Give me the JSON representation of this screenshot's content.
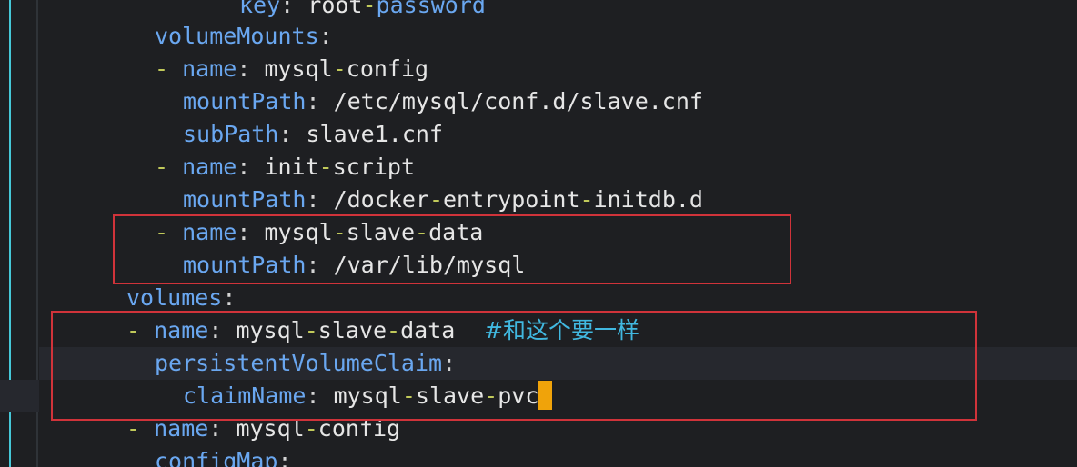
{
  "editor": {
    "lines": [
      {
        "key": "key",
        "sep": ": ",
        "value": [
          {
            "t": "root"
          },
          {
            "t": "-",
            "dash": true
          },
          {
            "t": "password",
            "blue": true
          }
        ]
      },
      {
        "key": "volumeMounts",
        "sep": ":"
      },
      {
        "dash": "- ",
        "key": "name",
        "sep": ": ",
        "value": [
          {
            "t": "mysql"
          },
          {
            "t": "-",
            "dash": true
          },
          {
            "t": "config"
          }
        ]
      },
      {
        "key": "mountPath",
        "sep": ": ",
        "value": [
          {
            "t": "/etc/mysql/conf.d/slave.cnf"
          }
        ]
      },
      {
        "key": "subPath",
        "sep": ": ",
        "value": [
          {
            "t": "slave1.cnf"
          }
        ]
      },
      {
        "dash": "- ",
        "key": "name",
        "sep": ": ",
        "value": [
          {
            "t": "init"
          },
          {
            "t": "-",
            "dash": true
          },
          {
            "t": "script"
          }
        ]
      },
      {
        "key": "mountPath",
        "sep": ": ",
        "value": [
          {
            "t": "/docker"
          },
          {
            "t": "-",
            "dash": true
          },
          {
            "t": "entrypoint"
          },
          {
            "t": "-",
            "dash": true
          },
          {
            "t": "initdb.d"
          }
        ]
      },
      {
        "dash": "- ",
        "key": "name",
        "sep": ": ",
        "value": [
          {
            "t": "mysql"
          },
          {
            "t": "-",
            "dash": true
          },
          {
            "t": "slave"
          },
          {
            "t": "-",
            "dash": true
          },
          {
            "t": "data"
          }
        ]
      },
      {
        "key": "mountPath",
        "sep": ": ",
        "value": [
          {
            "t": "/var/lib/mysql"
          }
        ]
      },
      {
        "key": "volumes",
        "sep": ":"
      },
      {
        "dash": "- ",
        "key": "name",
        "sep": ": ",
        "value": [
          {
            "t": "mysql"
          },
          {
            "t": "-",
            "dash": true
          },
          {
            "t": "slave"
          },
          {
            "t": "-",
            "dash": true
          },
          {
            "t": "data"
          }
        ],
        "comment": "    #和这个要一样"
      },
      {
        "key": "persistentVolumeClaim",
        "sep": ":"
      },
      {
        "key": "claimName",
        "sep": ": ",
        "value": [
          {
            "t": "mysql"
          },
          {
            "t": "-",
            "dash": true
          },
          {
            "t": "slave"
          },
          {
            "t": "-",
            "dash": true
          },
          {
            "t": "pvc"
          }
        ],
        "caret": true
      },
      {
        "dash": "- ",
        "key": "name",
        "sep": ": ",
        "value": [
          {
            "t": "mysql"
          },
          {
            "t": "-",
            "dash": true
          },
          {
            "t": "config"
          }
        ]
      },
      {
        "key": "configMap",
        "sep": ":"
      }
    ]
  },
  "colors": {
    "background": "#1e1f22",
    "key": "#6aa7f0",
    "dash": "#c1c95a",
    "comment": "#41b8e0",
    "caret": "#f0a30a",
    "highlight_box": "#d0333a",
    "indent_guide": "#46c8d8"
  }
}
